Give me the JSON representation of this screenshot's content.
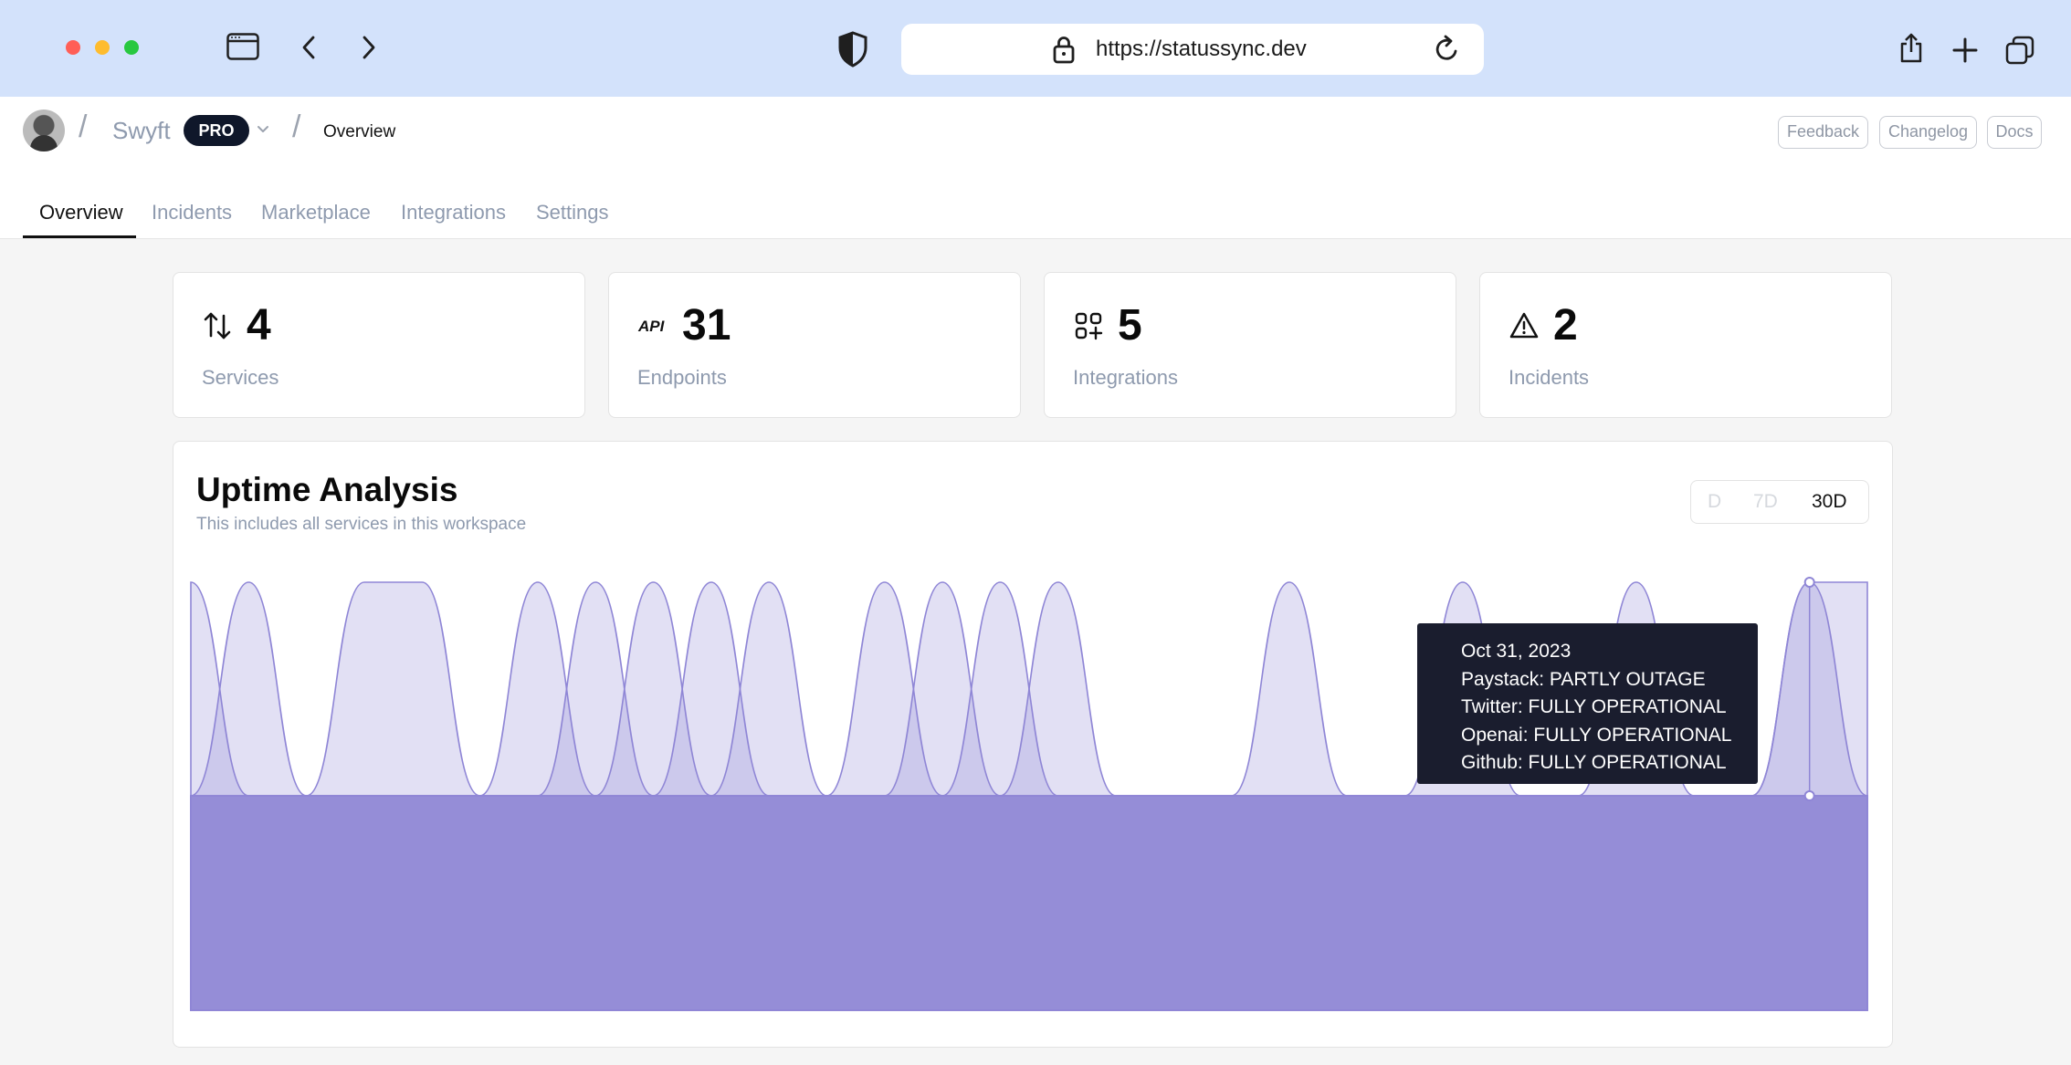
{
  "browser": {
    "url": "https://statussync.dev",
    "colors": {
      "bar": "#d3e2fb",
      "close": "#ff5f57",
      "minimize": "#febc2e",
      "zoom": "#28c840"
    }
  },
  "header": {
    "workspace": "Swyft",
    "plan_badge": "PRO",
    "breadcrumb_current": "Overview",
    "buttons": {
      "feedback": "Feedback",
      "changelog": "Changelog",
      "docs": "Docs"
    }
  },
  "tabs": [
    {
      "label": "Overview",
      "active": true
    },
    {
      "label": "Incidents",
      "active": false
    },
    {
      "label": "Marketplace",
      "active": false
    },
    {
      "label": "Integrations",
      "active": false
    },
    {
      "label": "Settings",
      "active": false
    }
  ],
  "stats": [
    {
      "icon": "arrows-up-down-icon",
      "value": "4",
      "label": "Services"
    },
    {
      "icon": "api-icon",
      "value": "31",
      "label": "Endpoints"
    },
    {
      "icon": "apps-add-icon",
      "value": "5",
      "label": "Integrations"
    },
    {
      "icon": "alert-triangle-icon",
      "value": "2",
      "label": "Incidents"
    }
  ],
  "uptime": {
    "title": "Uptime Analysis",
    "subtitle": "This includes all services in this workspace",
    "ranges": [
      {
        "label": "D",
        "active": false
      },
      {
        "label": "7D",
        "active": false
      },
      {
        "label": "30D",
        "active": true
      }
    ],
    "tooltip": {
      "date": "Oct 31, 2023",
      "lines": [
        "Paystack: PARTLY OUTAGE",
        "Twitter: FULLY OPERATIONAL",
        "Openai: FULLY OPERATIONAL",
        "Github: FULLY OPERATIONAL"
      ]
    }
  },
  "chart_data": {
    "type": "area",
    "points": 30,
    "series": [
      {
        "values": [
          2,
          1,
          1,
          1,
          1,
          1,
          1,
          1,
          1,
          1,
          1,
          1,
          1,
          1,
          1,
          1,
          1,
          1,
          1,
          1,
          1,
          1,
          1,
          1,
          1,
          1,
          1,
          1,
          1,
          1
        ]
      },
      {
        "values": [
          1,
          2,
          1,
          1,
          1,
          1,
          1,
          1,
          2,
          1,
          1,
          1,
          1,
          2,
          1,
          1,
          1,
          1,
          1,
          2,
          1,
          1,
          1,
          1,
          1,
          1,
          1,
          1,
          1,
          1
        ]
      },
      {
        "values": [
          1,
          1,
          1,
          2,
          2,
          1,
          1,
          1,
          1,
          1,
          2,
          1,
          1,
          1,
          1,
          1,
          1,
          1,
          1,
          1,
          1,
          1,
          2,
          1,
          1,
          1,
          1,
          1,
          2,
          1
        ]
      },
      {
        "values": [
          1,
          1,
          1,
          1,
          1,
          1,
          1,
          2,
          1,
          1,
          1,
          1,
          2,
          1,
          1,
          2,
          1,
          1,
          1,
          1,
          1,
          1,
          1,
          1,
          1,
          1,
          1,
          1,
          1,
          1
        ]
      },
      {
        "values": [
          1,
          1,
          1,
          1,
          1,
          1,
          2,
          1,
          1,
          2,
          1,
          1,
          1,
          1,
          2,
          1,
          1,
          1,
          1,
          1,
          1,
          1,
          1,
          1,
          1,
          2,
          1,
          1,
          1,
          1
        ]
      },
      {
        "values": [
          1,
          1,
          1,
          1,
          1,
          1,
          1,
          1,
          1,
          1,
          1,
          1,
          1,
          1,
          1,
          1,
          1,
          1,
          1,
          1,
          1,
          1,
          1,
          1,
          1,
          1,
          1,
          1,
          2,
          2
        ]
      }
    ],
    "highlight": {
      "date": "Oct 31, 2023",
      "point_index": 28
    },
    "color": "#8f86d6"
  }
}
